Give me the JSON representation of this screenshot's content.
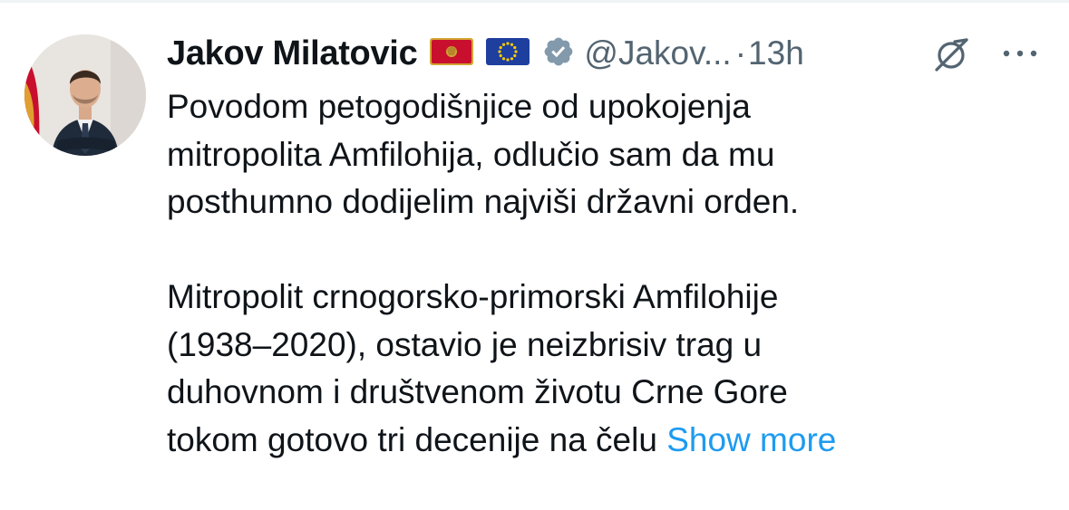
{
  "tweet": {
    "author": {
      "name": "Jakov Milatovic",
      "handle": "@Jakov...",
      "verified": true,
      "flags": [
        "montenegro-flag",
        "eu-flag"
      ]
    },
    "separator": "·",
    "time": "13h",
    "paragraph1": [
      "Povodom petogodišnjice od upokojenja",
      "mitropolita Amfilohija, odlučio sam da mu",
      "posthumno dodijelim najviši državni orden."
    ],
    "paragraph2": [
      "Mitropolit crnogorsko-primorski Amfilohije",
      "(1938–2020), ostavio je neizbrisiv trag u",
      "duhovnom i društvenom životu Crne Gore",
      "tokom gotovo tri decenije na čelu"
    ],
    "show_more": "Show more"
  },
  "colors": {
    "text": "#0f1419",
    "secondary": "#536471",
    "link": "#1d9bf0",
    "verified_badge": "#829aab"
  },
  "icons": [
    "grok-icon",
    "more-icon",
    "verified-badge-icon"
  ]
}
